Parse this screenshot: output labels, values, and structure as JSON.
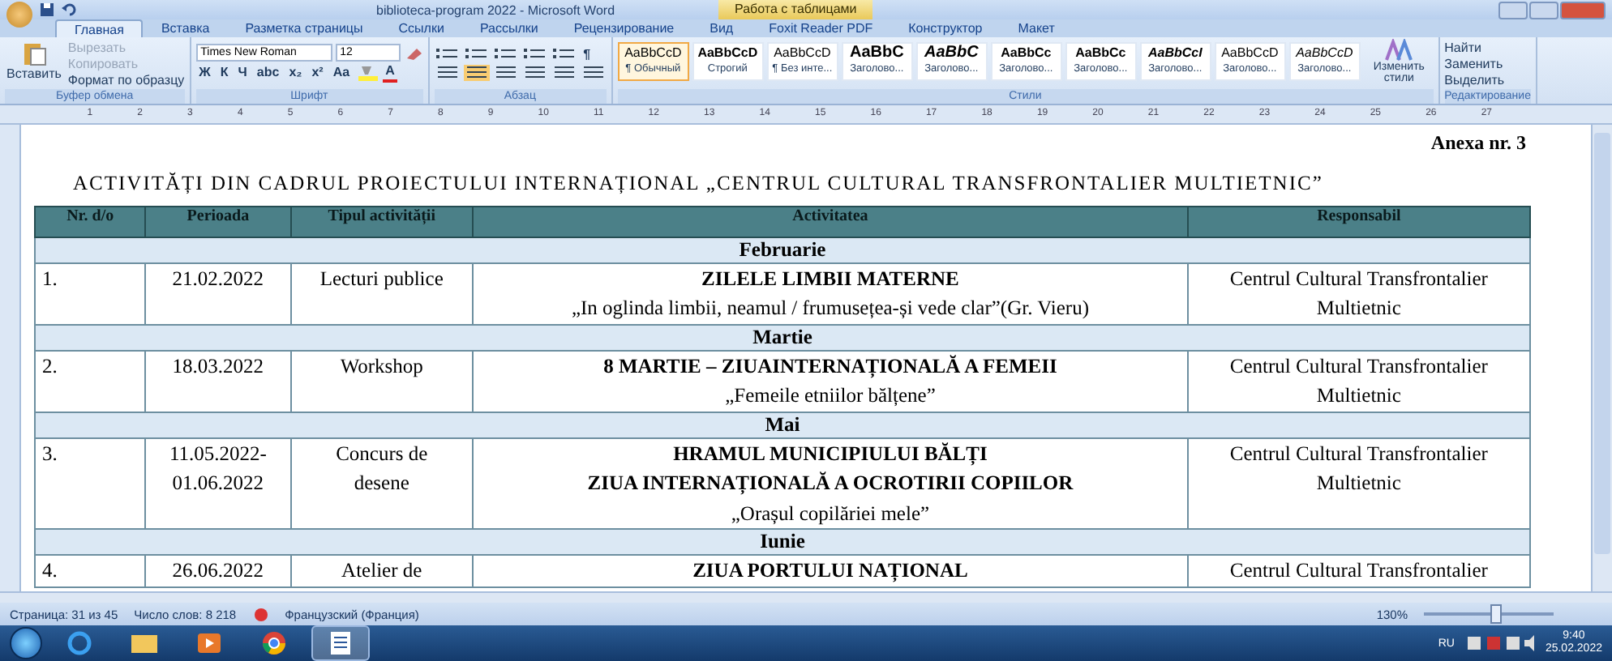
{
  "window": {
    "title": "biblioteca-program 2022 - Microsoft Word",
    "context_tab": "Работа с таблицами"
  },
  "tabs": [
    {
      "label": "Главная",
      "selected": true
    },
    {
      "label": "Вставка",
      "selected": false
    },
    {
      "label": "Разметка страницы",
      "selected": false
    },
    {
      "label": "Ссылки",
      "selected": false
    },
    {
      "label": "Рассылки",
      "selected": false
    },
    {
      "label": "Рецензирование",
      "selected": false
    },
    {
      "label": "Вид",
      "selected": false
    },
    {
      "label": "Foxit Reader PDF",
      "selected": false
    },
    {
      "label": "Конструктор",
      "selected": false
    },
    {
      "label": "Макет",
      "selected": false
    }
  ],
  "clipboard": {
    "paste": "Вставить",
    "items": [
      {
        "label": "Вырезать",
        "disabled": true
      },
      {
        "label": "Копировать",
        "disabled": true
      },
      {
        "label": "Формат по образцу",
        "disabled": false
      }
    ],
    "label": "Буфер обмена"
  },
  "font": {
    "name": "Times New Roman",
    "size": "12",
    "format_buttons": [
      "Ж",
      "К",
      "Ч",
      "abc",
      "x₂",
      "x²",
      "Aa"
    ],
    "color_letter": "A",
    "label": "Шрифт"
  },
  "paragraph": {
    "pilcrow": "¶",
    "label": "Абзац"
  },
  "styles": {
    "items": [
      {
        "preview": "AaBbCcD",
        "name": "¶ Обычный",
        "kind": "plain",
        "selected": true
      },
      {
        "preview": "AaBbCcD",
        "name": "Строгий",
        "kind": "bold",
        "selected": false
      },
      {
        "preview": "AaBbCcD",
        "name": "¶ Без инте...",
        "kind": "plain",
        "selected": false
      },
      {
        "preview": "AaBbC",
        "name": "Заголово...",
        "kind": "heading",
        "selected": false
      },
      {
        "preview": "AaBbC",
        "name": "Заголово...",
        "kind": "heading-italic",
        "selected": false
      },
      {
        "preview": "AaBbCc",
        "name": "Заголово...",
        "kind": "bold",
        "selected": false
      },
      {
        "preview": "AaBbCc",
        "name": "Заголово...",
        "kind": "bold",
        "selected": false
      },
      {
        "preview": "AaBbCcI",
        "name": "Заголово...",
        "kind": "bold-italic",
        "selected": false
      },
      {
        "preview": "AaBbCcD",
        "name": "Заголово...",
        "kind": "plain",
        "selected": false
      },
      {
        "preview": "AaBbCcD",
        "name": "Заголово...",
        "kind": "italic",
        "selected": false
      }
    ],
    "change_styles": "Изменить стили",
    "label": "Стили"
  },
  "editing": {
    "items": [
      "Найти",
      "Заменить",
      "Выделить"
    ],
    "label": "Редактирование"
  },
  "ruler": [
    "1",
    "2",
    "3",
    "4",
    "5",
    "6",
    "7",
    "8",
    "9",
    "10",
    "11",
    "12",
    "13",
    "14",
    "15",
    "16",
    "17",
    "18",
    "19",
    "20",
    "21",
    "22",
    "23",
    "24",
    "25",
    "26",
    "27"
  ],
  "document": {
    "annex": "Anexa nr. 3",
    "title": "ACTIVITĂȚI DIN CADRUL PROIECTULUI INTERNAȚIONAL „CENTRUL CULTURAL TRANSFRONTALIER MULTIETNIC”",
    "columns": [
      "Nr. d/o",
      "Perioada",
      "Tipul activității",
      "Activitatea",
      "Responsabil"
    ],
    "sections": [
      {
        "name": "Februarie",
        "rows": [
          {
            "nr": "1.",
            "period": [
              "21.02.2022"
            ],
            "type": [
              "Lecturi publice"
            ],
            "activity": [
              {
                "text": "ZILELE LIMBII MATERNE",
                "bold": true
              },
              {
                "text": "„In oglinda limbii, neamul / frumusețea-și vede clar”(Gr. Vieru)",
                "bold": false
              }
            ],
            "responsible": [
              "Centrul Cultural Transfrontalier",
              "Multietnic"
            ]
          }
        ]
      },
      {
        "name": "Martie",
        "rows": [
          {
            "nr": "2.",
            "period": [
              "18.03.2022"
            ],
            "type": [
              "Workshop"
            ],
            "activity": [
              {
                "text": "8 MARTIE – ZIUAINTERNAȚIONALĂ  A FEMEII",
                "bold": true
              },
              {
                "text": "„Femeile etniilor bălțene”",
                "bold": false
              }
            ],
            "responsible": [
              "Centrul Cultural Transfrontalier",
              "Multietnic"
            ]
          }
        ]
      },
      {
        "name": "Mai",
        "rows": [
          {
            "nr": "3.",
            "period": [
              "11.05.2022-",
              "01.06.2022"
            ],
            "type": [
              "Concurs de",
              "desene"
            ],
            "activity": [
              {
                "text": "HRAMUL MUNICIPIULUI BĂLȚI",
                "bold": true
              },
              {
                "text": "ZIUA INTERNAȚIONALĂ  A OCROTIRII COPIILOR",
                "bold": true
              },
              {
                "text": "„Orașul copilăriei mele”",
                "bold": false
              }
            ],
            "responsible": [
              "Centrul Cultural Transfrontalier",
              "Multietnic"
            ]
          }
        ]
      },
      {
        "name": "Iunie",
        "rows": [
          {
            "nr": "4.",
            "period": [
              "26.06.2022"
            ],
            "type": [
              "Atelier de"
            ],
            "activity": [
              {
                "text": "ZIUA PORTULUI NAȚIONAL",
                "bold": true
              }
            ],
            "responsible": [
              "Centrul Cultural Transfrontalier"
            ]
          }
        ]
      }
    ]
  },
  "status_bar": {
    "page": "Страница: 31 из 45",
    "words": "Число слов: 8 218",
    "language": "Французский (Франция)",
    "zoom": "130%",
    "level": 0.55
  },
  "taskbar": {
    "apps": [
      {
        "kind": "browser",
        "selected": false
      },
      {
        "kind": "folder",
        "selected": false
      },
      {
        "kind": "media",
        "selected": false
      },
      {
        "kind": "chrome",
        "selected": false
      },
      {
        "kind": "word",
        "selected": true
      }
    ],
    "language": "RU",
    "time": "9:40",
    "date": "25.02.2022"
  }
}
